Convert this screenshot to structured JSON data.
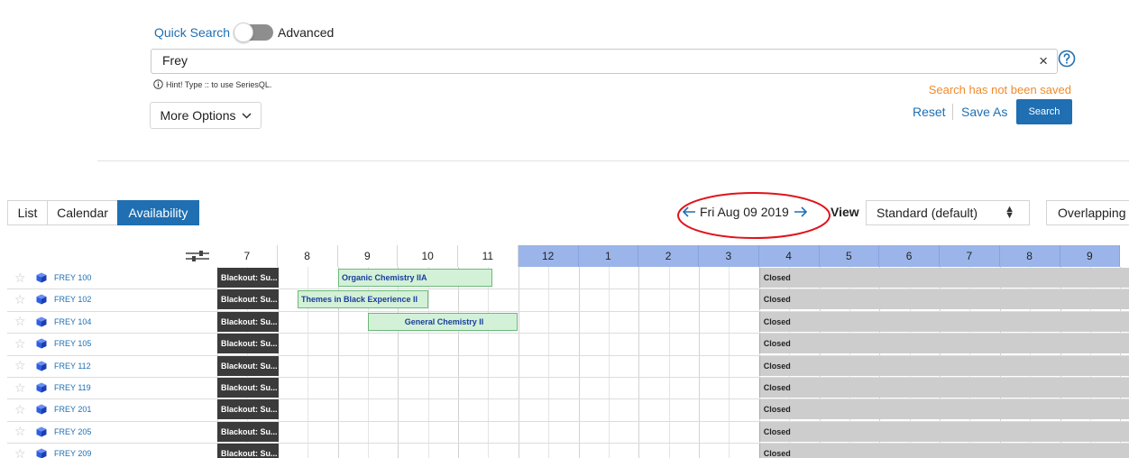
{
  "search": {
    "quick_search_label": "Quick Search",
    "advanced_label": "Advanced",
    "query_value": "Frey",
    "clear_symbol": "×",
    "hint_text": "Hint! Type :: to use SeriesQL.",
    "more_options_label": "More Options",
    "not_saved_text": "Search has not been saved",
    "reset_label": "Reset",
    "save_as_label": "Save As",
    "search_button_label": "Search"
  },
  "tabs": [
    {
      "label": "List",
      "active": false
    },
    {
      "label": "Calendar",
      "active": false
    },
    {
      "label": "Availability",
      "active": true
    }
  ],
  "nav": {
    "date_label": "Fri Aug 09 2019",
    "view_label": "View",
    "view_select_value": "Standard (default)",
    "overlapping_label": "Overlapping"
  },
  "grid": {
    "hours": [
      "7",
      "8",
      "9",
      "10",
      "11",
      "12",
      "1",
      "2",
      "3",
      "4",
      "5",
      "6",
      "7",
      "8",
      "9"
    ],
    "rooms": [
      "FREY 100",
      "FREY 102",
      "FREY 104",
      "FREY 105",
      "FREY 112",
      "FREY 119",
      "FREY 201",
      "FREY 205",
      "FREY 209"
    ],
    "blackout_label": "Blackout: Su...",
    "closed_label": "Closed",
    "events": [
      {
        "row": 0,
        "label": "Organic Chemistry IIA"
      },
      {
        "row": 1,
        "label": "Themes in Black Experience II"
      },
      {
        "row": 2,
        "label": "General Chemistry II"
      }
    ]
  },
  "colors": {
    "accent": "#1f6fb2",
    "warning_text": "#ef8b2c",
    "pm_header": "#9bb5ea",
    "blackout": "#3b3b3b",
    "closed": "#cdcdcd",
    "event_fill": "#d3f1d7",
    "annotation_circle": "#e0141c"
  },
  "icons": {
    "toggle": "toggle-switch-icon",
    "help": "help-circle-icon",
    "hint": "info-icon",
    "more_options": "chevron-down-icon",
    "prev": "arrow-left-icon",
    "next": "arrow-right-icon",
    "select": "sort-caret-icon",
    "columns": "slider-settings-icon",
    "star": "star-outline-icon",
    "room": "cube-icon"
  }
}
